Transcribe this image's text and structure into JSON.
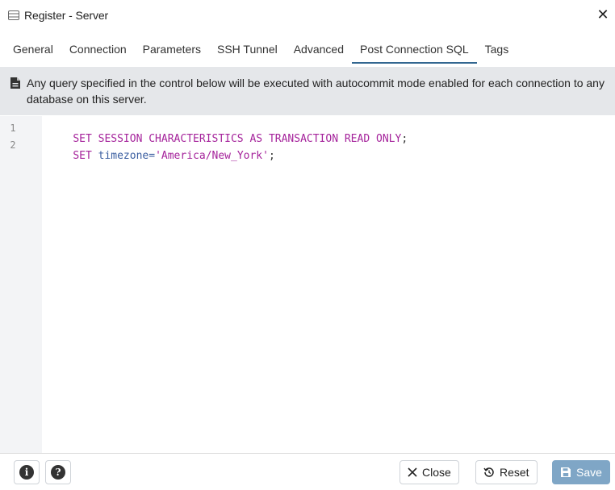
{
  "window": {
    "title": "Register - Server",
    "icon": "server-icon",
    "close_icon": "close-icon"
  },
  "tabs": [
    {
      "label": "General",
      "active": false
    },
    {
      "label": "Connection",
      "active": false
    },
    {
      "label": "Parameters",
      "active": false
    },
    {
      "label": "SSH Tunnel",
      "active": false
    },
    {
      "label": "Advanced",
      "active": false
    },
    {
      "label": "Post Connection SQL",
      "active": true
    },
    {
      "label": "Tags",
      "active": false
    }
  ],
  "notice": {
    "icon": "document-icon",
    "text": "Any query specified in the control below will be executed with autocommit mode enabled for each connection to any database on this server."
  },
  "editor": {
    "lines": [
      {
        "number": "1",
        "tokens": {
          "t1": "SET SESSION CHARACTERISTICS AS TRANSACTION READ ONLY",
          "t2": ";"
        }
      },
      {
        "number": "2",
        "tokens": {
          "t1": "SET",
          "t2": " timezone=",
          "t3": "'America/New_York'",
          "t4": ";"
        }
      }
    ]
  },
  "footer": {
    "info_icon": "info-icon",
    "help_icon": "help-icon",
    "close_label": "Close",
    "reset_label": "Reset",
    "save_label": "Save"
  },
  "colors": {
    "accent": "#326690",
    "keyword": "#a5239b",
    "identifier": "#3a5ea0",
    "notice_bg": "#e5e7ea",
    "save_disabled": "#7fa6c6"
  }
}
